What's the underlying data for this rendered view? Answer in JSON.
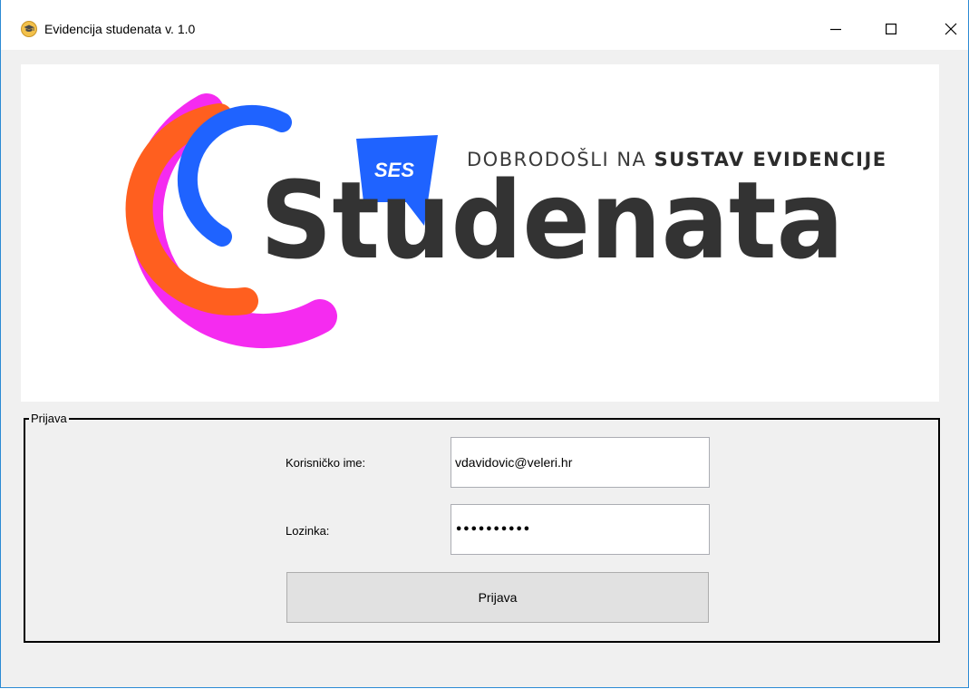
{
  "window": {
    "title": "Evidencija studenata v. 1.0",
    "controls": {
      "minimize_icon": "minimize-icon",
      "maximize_icon": "maximize-icon",
      "close_icon": "close-icon"
    }
  },
  "banner": {
    "badge": "SES",
    "welcome_prefix": "DOBRODOŠLI NA ",
    "welcome_bold": "SUSTAV EVIDENCIJE",
    "wordmark": "Studenata",
    "colors": {
      "magenta": "#f52bf0",
      "orange": "#ff5f1f",
      "blue": "#1f63ff",
      "text": "#333333"
    }
  },
  "login": {
    "group_title": "Prijava",
    "username_label": "Korisničko ime:",
    "username_value": "vdavidovic@veleri.hr",
    "password_label": "Lozinka:",
    "password_value": "••••••••••",
    "submit_label": "Prijava"
  }
}
